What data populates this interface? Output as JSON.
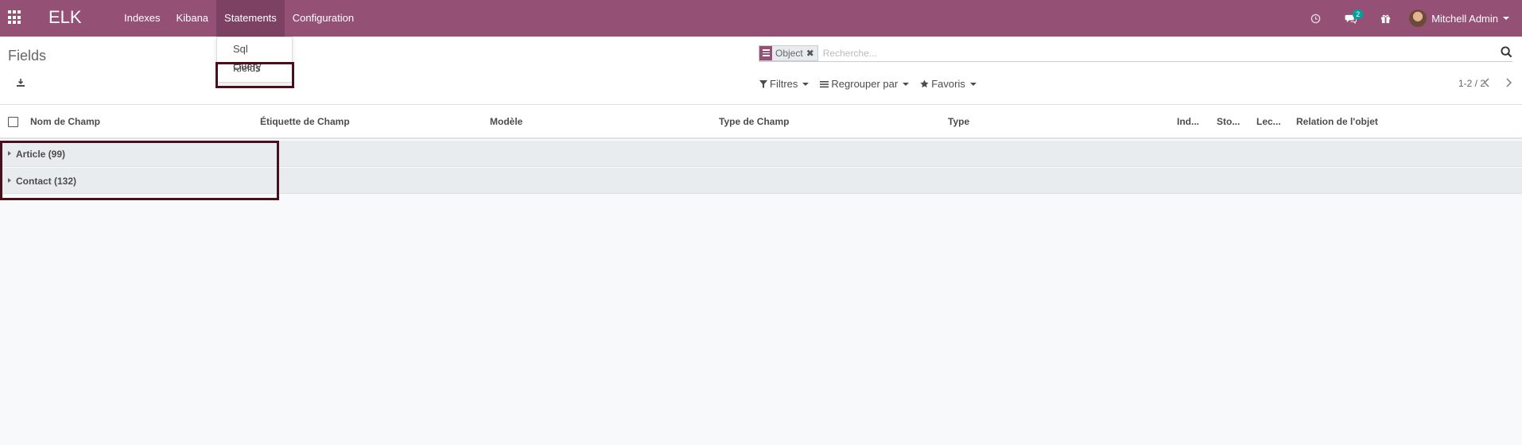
{
  "navbar": {
    "brand": "ELK",
    "menu": [
      "Indexes",
      "Kibana",
      "Statements",
      "Configuration"
    ],
    "active_menu": "Statements",
    "messages_badge": "2",
    "user_name": "Mitchell Admin"
  },
  "dropdown": {
    "items": [
      "Sql Query",
      "Fields"
    ]
  },
  "control_panel": {
    "title": "Fields",
    "search_facet": "Object",
    "search_placeholder": "Recherche...",
    "filters_label": "Filtres",
    "group_by_label": "Regrouper par",
    "favorites_label": "Favoris",
    "pager": "1-2 / 2"
  },
  "table": {
    "columns": [
      "Nom de Champ",
      "Étiquette de Champ",
      "Modèle",
      "Type de Champ",
      "Type",
      "Ind...",
      "Sto...",
      "Lec...",
      "Relation de l'objet"
    ],
    "groups": [
      "Article (99)",
      "Contact (132)"
    ]
  },
  "colors": {
    "brand": "#955075",
    "highlight": "#4a0f1c",
    "badge": "#00a09d"
  }
}
